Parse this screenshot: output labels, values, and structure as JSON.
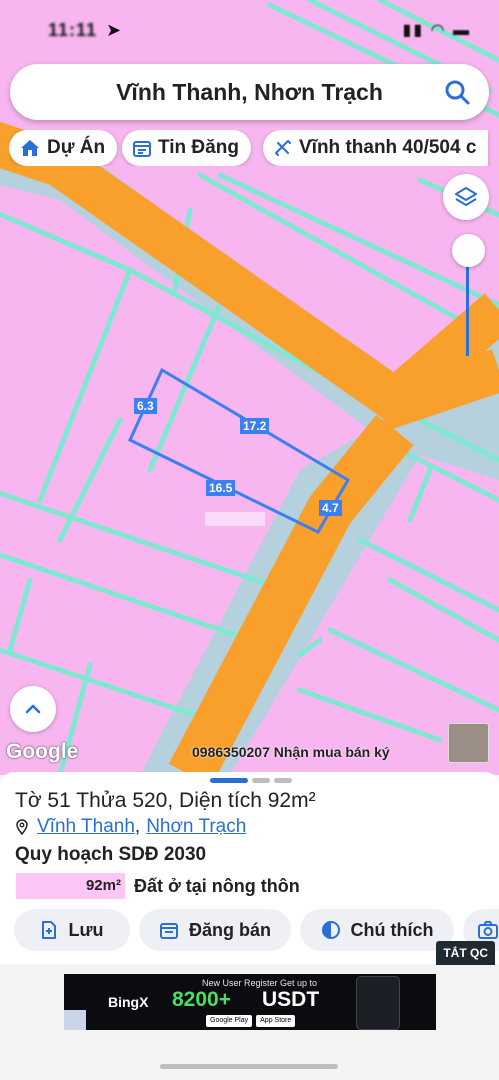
{
  "status_bar": {
    "time": "11:11",
    "location_arrow": "location-arrow-icon",
    "right_icons": "signal wifi"
  },
  "search": {
    "query": "Vĩnh Thanh, Nhơn Trạch",
    "icon": "search-icon"
  },
  "chips": [
    {
      "label": "Dự Án",
      "icon": "home-icon"
    },
    {
      "label": "Tin Đăng",
      "icon": "calendar-icon"
    },
    {
      "label": "Vĩnh thanh 40/504 c",
      "icon": "ruler-icon"
    }
  ],
  "map": {
    "dimensions": [
      "6.3",
      "17.2",
      "16.5",
      "4.7"
    ],
    "google_label": "Google",
    "ad_banner": "0986350207 Nhận mua bán ký",
    "colors": {
      "land": "#f7b6f0",
      "road": "#f9a02c",
      "parcel_line": "#7fe8d0",
      "selection": "#3b7ff2"
    }
  },
  "info": {
    "title": "Tờ 51 Thửa 520, Diện tích 92m²",
    "commune": "Vĩnh Thanh",
    "separator": ",",
    "district": "Nhơn Trạch",
    "plan_heading": "Quy hoạch SDĐ 2030",
    "plan_area": "92m²",
    "plan_use": "Đất ở tại nông thôn"
  },
  "actions": [
    {
      "label": "Lưu",
      "icon": "save-icon"
    },
    {
      "label": "Đăng bán",
      "icon": "calendar-icon"
    },
    {
      "label": "Chú thích",
      "icon": "contrast-icon"
    },
    {
      "label": "",
      "icon": "camera-icon"
    }
  ],
  "ad_toggle": "TẮT QC",
  "ad": {
    "brand": "BingX",
    "headline_top": "New User Register Get up to",
    "amount": "8200+",
    "currency": "USDT",
    "store_google": "Google Play",
    "store_apple": "App Store"
  }
}
